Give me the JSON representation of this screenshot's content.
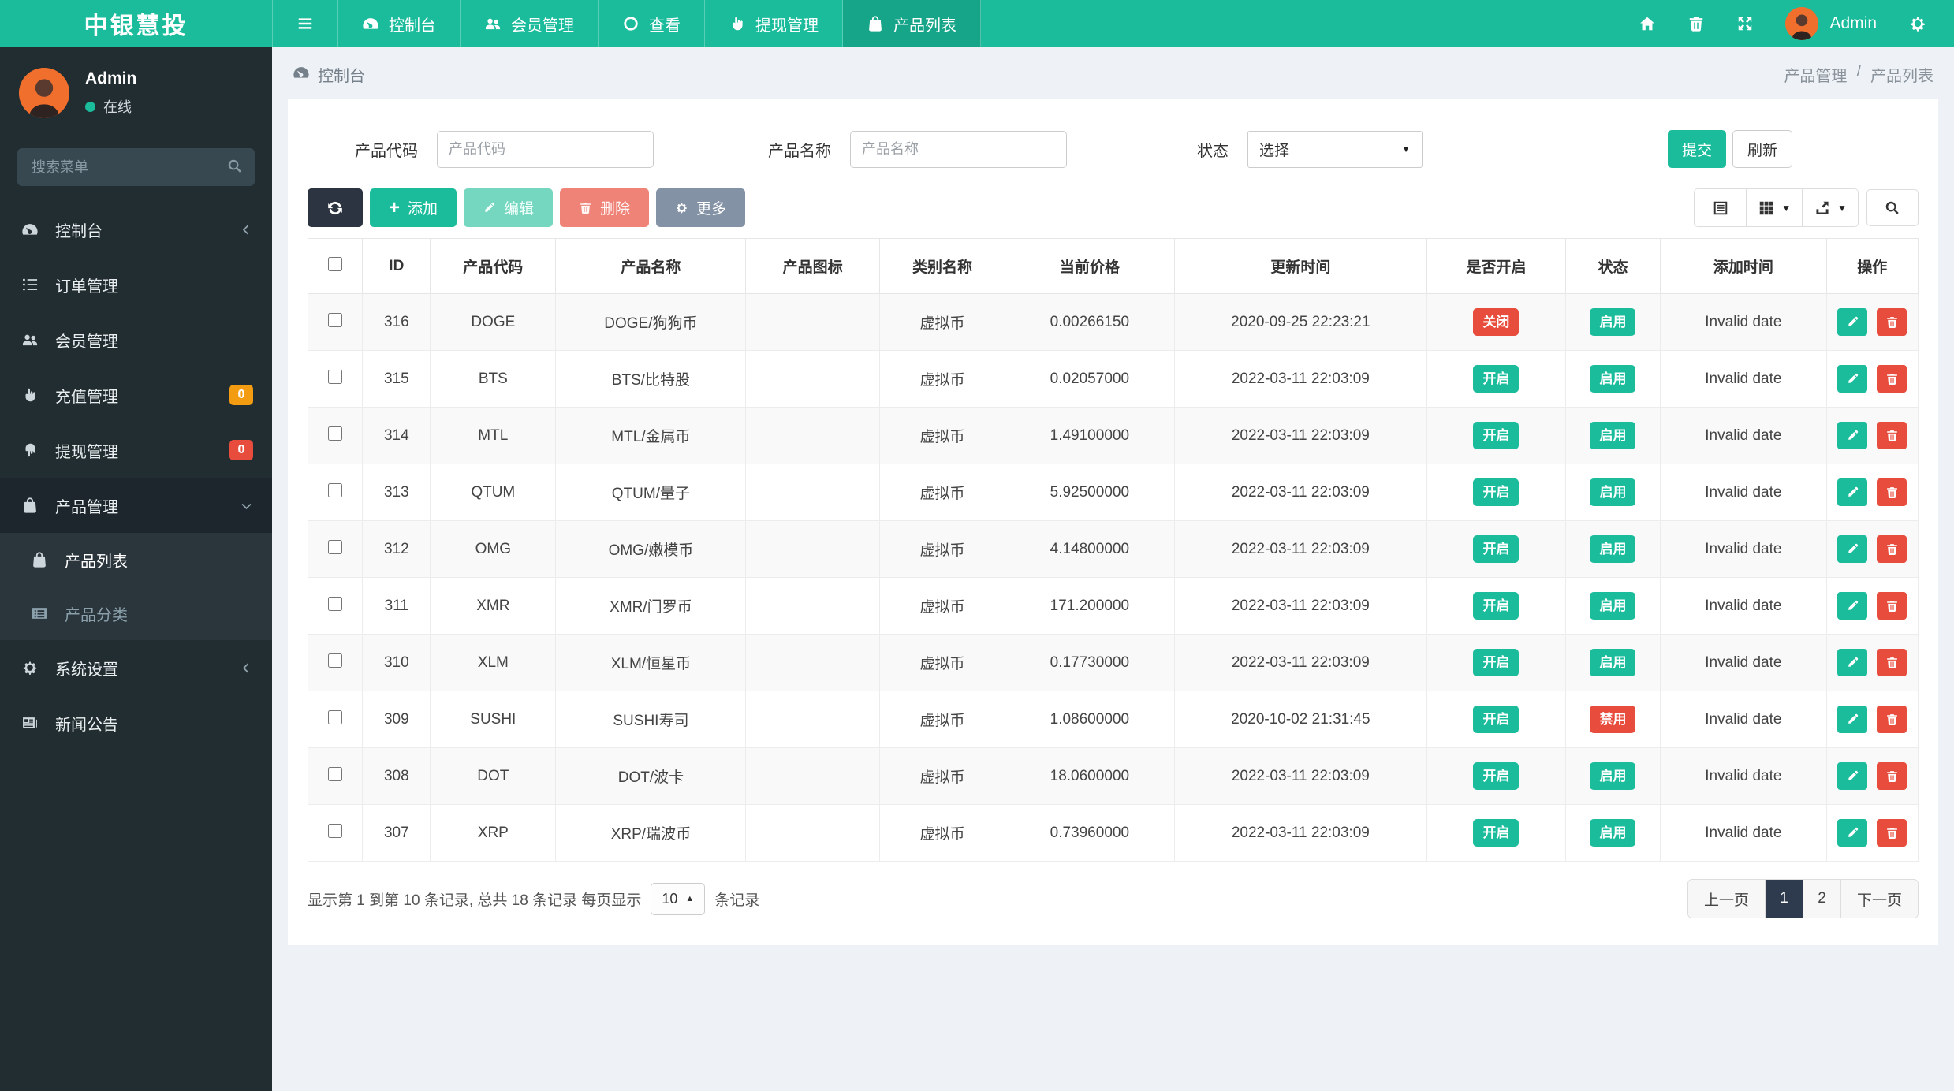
{
  "colors": {
    "accent": "#1abc9c",
    "navbar_active": "#17a589",
    "sidebar_bg": "#222d32",
    "danger": "#e74c3c",
    "warning": "#f39c12",
    "pagination_active": "#2e3a4d"
  },
  "brand": {
    "title": "中银慧投"
  },
  "navbar": {
    "menu": [
      {
        "label": "控制台"
      },
      {
        "label": "会员管理"
      },
      {
        "label": "查看"
      },
      {
        "label": "提现管理"
      },
      {
        "label": "产品列表"
      }
    ],
    "user": "Admin"
  },
  "sidebar": {
    "user": {
      "name": "Admin",
      "status": "在线"
    },
    "search_placeholder": "搜索菜单",
    "items": [
      {
        "label": "控制台"
      },
      {
        "label": "订单管理"
      },
      {
        "label": "会员管理"
      },
      {
        "label": "充值管理",
        "badge": "0"
      },
      {
        "label": "提现管理",
        "badge": "0"
      },
      {
        "label": "产品管理"
      },
      {
        "label": "系统设置"
      },
      {
        "label": "新闻公告"
      }
    ],
    "submenu": [
      {
        "label": "产品列表"
      },
      {
        "label": "产品分类"
      }
    ]
  },
  "breadcrumb": {
    "left": "控制台",
    "right_parent": "产品管理",
    "separator": "/",
    "right_current": "产品列表"
  },
  "filters": {
    "code_label": "产品代码",
    "code_placeholder": "产品代码",
    "name_label": "产品名称",
    "name_placeholder": "产品名称",
    "status_label": "状态",
    "status_value": "选择",
    "submit": "提交",
    "refresh": "刷新"
  },
  "toolbar": {
    "add": "添加",
    "edit": "编辑",
    "delete": "删除",
    "more": "更多"
  },
  "table": {
    "columns": [
      "ID",
      "产品代码",
      "产品名称",
      "产品图标",
      "类别名称",
      "当前价格",
      "更新时间",
      "是否开启",
      "状态",
      "添加时间",
      "操作"
    ],
    "rows": [
      {
        "id": "316",
        "code": "DOGE",
        "name": "DOGE/狗狗币",
        "icon": "",
        "category": "虚拟币",
        "price": "0.00266150",
        "updated": "2020-09-25 22:23:21",
        "open": "关闭",
        "open_class": "danger",
        "status": "启用",
        "status_class": "success",
        "added": "Invalid date"
      },
      {
        "id": "315",
        "code": "BTS",
        "name": "BTS/比特股",
        "icon": "",
        "category": "虚拟币",
        "price": "0.02057000",
        "updated": "2022-03-11 22:03:09",
        "open": "开启",
        "open_class": "success",
        "status": "启用",
        "status_class": "success",
        "added": "Invalid date"
      },
      {
        "id": "314",
        "code": "MTL",
        "name": "MTL/金属币",
        "icon": "",
        "category": "虚拟币",
        "price": "1.49100000",
        "updated": "2022-03-11 22:03:09",
        "open": "开启",
        "open_class": "success",
        "status": "启用",
        "status_class": "success",
        "added": "Invalid date"
      },
      {
        "id": "313",
        "code": "QTUM",
        "name": "QTUM/量子",
        "icon": "",
        "category": "虚拟币",
        "price": "5.92500000",
        "updated": "2022-03-11 22:03:09",
        "open": "开启",
        "open_class": "success",
        "status": "启用",
        "status_class": "success",
        "added": "Invalid date"
      },
      {
        "id": "312",
        "code": "OMG",
        "name": "OMG/嫩模币",
        "icon": "",
        "category": "虚拟币",
        "price": "4.14800000",
        "updated": "2022-03-11 22:03:09",
        "open": "开启",
        "open_class": "success",
        "status": "启用",
        "status_class": "success",
        "added": "Invalid date"
      },
      {
        "id": "311",
        "code": "XMR",
        "name": "XMR/门罗币",
        "icon": "",
        "category": "虚拟币",
        "price": "171.200000",
        "updated": "2022-03-11 22:03:09",
        "open": "开启",
        "open_class": "success",
        "status": "启用",
        "status_class": "success",
        "added": "Invalid date"
      },
      {
        "id": "310",
        "code": "XLM",
        "name": "XLM/恒星币",
        "icon": "",
        "category": "虚拟币",
        "price": "0.17730000",
        "updated": "2022-03-11 22:03:09",
        "open": "开启",
        "open_class": "success",
        "status": "启用",
        "status_class": "success",
        "added": "Invalid date"
      },
      {
        "id": "309",
        "code": "SUSHI",
        "name": "SUSHI寿司",
        "icon": "",
        "category": "虚拟币",
        "price": "1.08600000",
        "updated": "2020-10-02 21:31:45",
        "open": "开启",
        "open_class": "success",
        "status": "禁用",
        "status_class": "danger",
        "added": "Invalid date"
      },
      {
        "id": "308",
        "code": "DOT",
        "name": "DOT/波卡",
        "icon": "",
        "category": "虚拟币",
        "price": "18.0600000",
        "updated": "2022-03-11 22:03:09",
        "open": "开启",
        "open_class": "success",
        "status": "启用",
        "status_class": "success",
        "added": "Invalid date"
      },
      {
        "id": "307",
        "code": "XRP",
        "name": "XRP/瑞波币",
        "icon": "",
        "category": "虚拟币",
        "price": "0.73960000",
        "updated": "2022-03-11 22:03:09",
        "open": "开启",
        "open_class": "success",
        "status": "启用",
        "status_class": "success",
        "added": "Invalid date"
      }
    ]
  },
  "pagination": {
    "summary": "显示第 1 到第 10 条记录, 总共 18 条记录 每页显示",
    "page_size": "10",
    "summary_suffix": "条记录",
    "prev": "上一页",
    "page1": "1",
    "page2": "2",
    "next": "下一页"
  }
}
